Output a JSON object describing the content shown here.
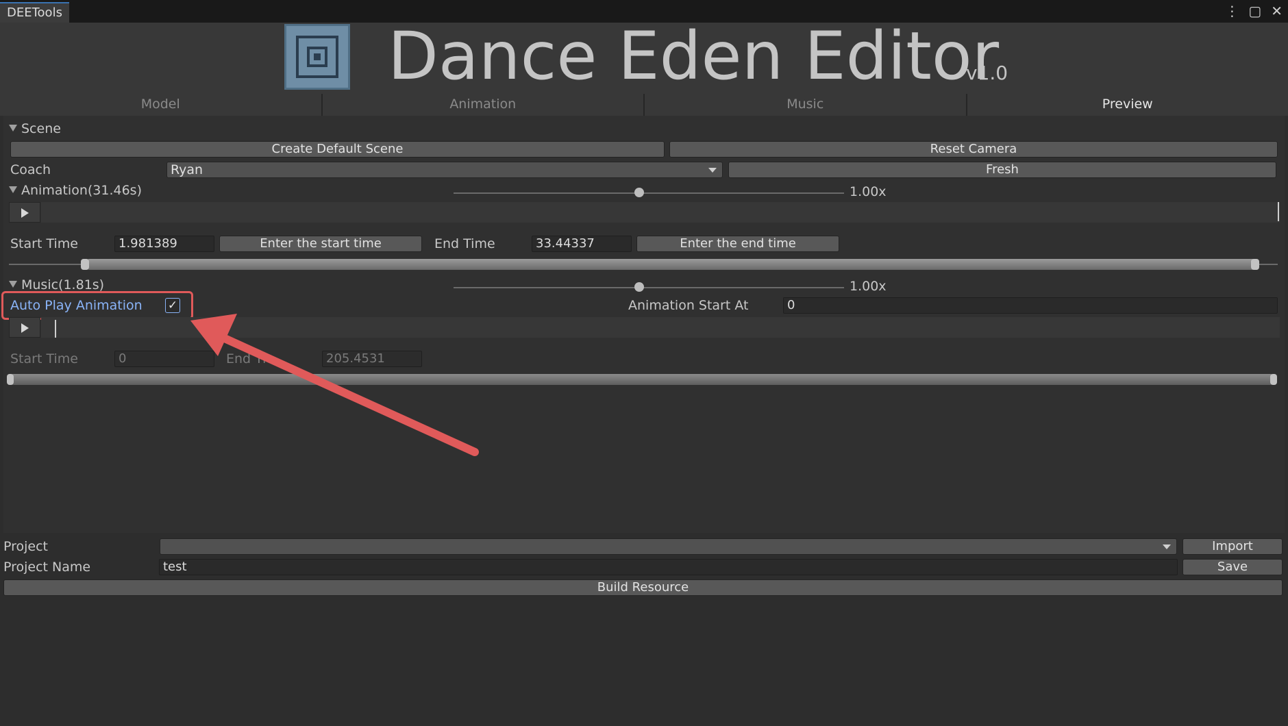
{
  "window": {
    "tab_title": "DEETools",
    "menu_icon": "⋮",
    "maximize_icon": "▢",
    "close_icon": "✕"
  },
  "header": {
    "title": "Dance Eden Editor",
    "version": "v1.0"
  },
  "tabs": [
    "Model",
    "Animation",
    "Music",
    "Preview"
  ],
  "scene": {
    "header": "Scene",
    "create_default_scene": "Create Default Scene",
    "reset_camera": "Reset Camera",
    "coach_label": "Coach",
    "coach_value": "Ryan",
    "fresh": "Fresh"
  },
  "animation": {
    "header": "Animation(31.46s)",
    "speed": "1.00x",
    "speed_value": 1.0,
    "start_time_label": "Start Time",
    "start_time_value": "1.981389",
    "enter_start": "Enter the start time",
    "end_time_label": "End Time",
    "end_time_value": "33.44337",
    "enter_end": "Enter the end time"
  },
  "music": {
    "header": "Music(1.81s)",
    "speed": "1.00x",
    "speed_value": 1.0,
    "auto_play_label": "Auto Play Animation",
    "auto_play_checked": true,
    "check_glyph": "✓",
    "animation_start_at_label": "Animation Start At",
    "animation_start_at_value": "0",
    "start_time_label": "Start Time",
    "start_time_value": "0",
    "end_time_label": "End Ti",
    "end_time_value": "205.4531"
  },
  "project": {
    "project_label": "Project",
    "project_value": "",
    "import": "Import",
    "name_label": "Project Name",
    "name_value": "test",
    "save": "Save",
    "build": "Build Resource"
  },
  "colors": {
    "accent": "#8ab4f8",
    "highlight": "#e05a5a",
    "background": "#2d2d2d"
  }
}
